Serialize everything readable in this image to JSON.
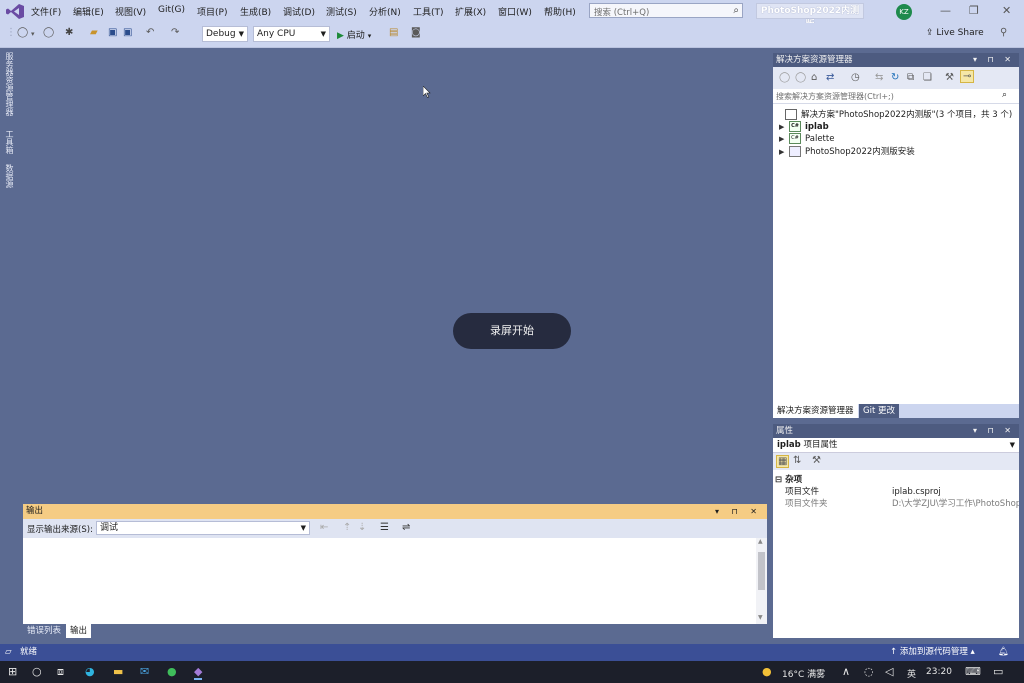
{
  "menu": {
    "items": [
      "文件(F)",
      "编辑(E)",
      "视图(V)",
      "Git(G)",
      "项目(P)",
      "生成(B)",
      "调试(D)",
      "测试(S)",
      "分析(N)",
      "工具(T)",
      "扩展(X)",
      "窗口(W)",
      "帮助(H)"
    ],
    "search_placeholder": "搜索 (Ctrl+Q)",
    "project_title": "PhotoShop2022内测版",
    "avatar_initials": "KZ"
  },
  "toolbar": {
    "config": "Debug",
    "platform": "Any CPU",
    "start_label": "启动",
    "live_share": "Live Share"
  },
  "left_tabs": [
    "服务器资源管理器",
    "工具箱",
    "数据源"
  ],
  "center": {
    "recording_label": "录屏开始"
  },
  "solution_explorer": {
    "title": "解决方案资源管理器",
    "search_placeholder": "搜索解决方案资源管理器(Ctrl+;)",
    "solution_label": "解决方案\"PhotoShop2022内测版\"(3 个项目，共 3 个)",
    "projects": [
      "iplab",
      "Palette",
      "PhotoShop2022内测版安装"
    ],
    "tabs": [
      "解决方案资源管理器",
      "Git 更改"
    ]
  },
  "properties": {
    "title": "属性",
    "selector_name": "iplab",
    "selector_desc": "项目属性",
    "category": "杂项",
    "rows": [
      {
        "name": "项目文件",
        "value": "iplab.csproj"
      },
      {
        "name": "项目文件夹",
        "value": "D:\\大学ZJU\\学习工作\\PhotoShop"
      }
    ]
  },
  "output": {
    "title": "输出",
    "source_label": "显示输出来源(S):",
    "source_value": "调试",
    "tabs": [
      "错误列表",
      "输出"
    ]
  },
  "statusbar": {
    "ready": "就绪",
    "source_control": "添加到源代码管理"
  },
  "taskbar": {
    "weather": "16°C 满雾",
    "ime": "英",
    "time": "23:20"
  }
}
